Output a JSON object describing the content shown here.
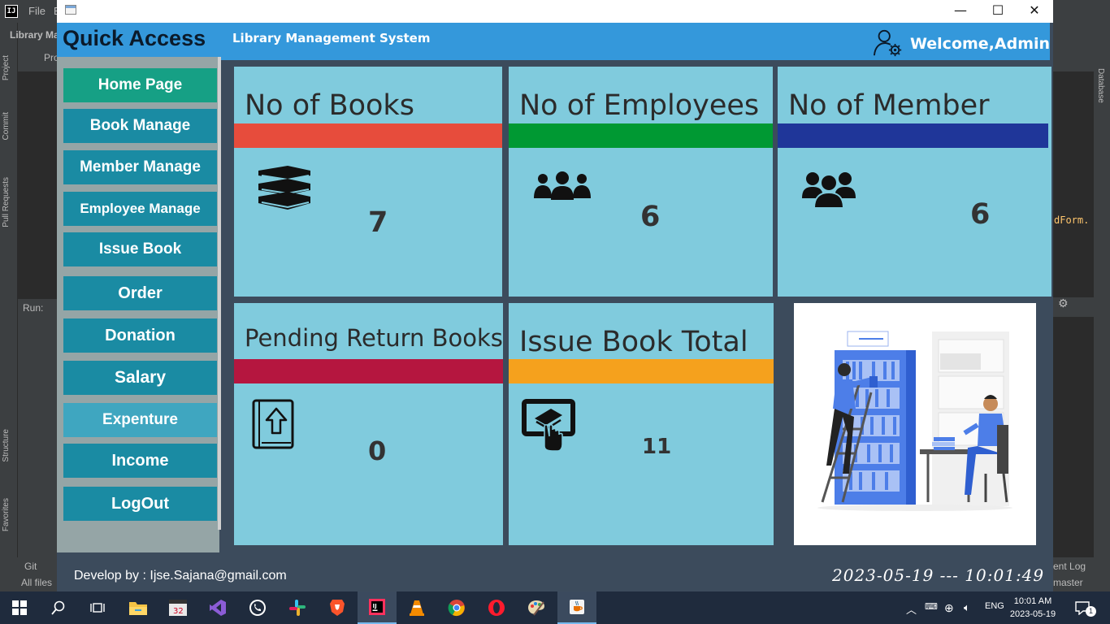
{
  "ide": {
    "menu_file": "File",
    "menu_edit": "E",
    "project_title": "Library Ma",
    "project_node": "Pro",
    "run_label": "Run:",
    "left_tabs": [
      "Project",
      "Commit",
      "Pull Requests",
      "Structure",
      "Favorites"
    ],
    "right_tab": "Database",
    "code_snippet": "dForm.",
    "git_label": "Git",
    "all_files": "All files",
    "event_log": "ent Log",
    "branch": "master"
  },
  "window": {
    "minimize": "—",
    "maximize": "☐",
    "close": "✕"
  },
  "header": {
    "quick_access": "Quick Access",
    "system_title": "Library Management System",
    "welcome": "Welcome,Admin"
  },
  "sidebar": {
    "items": [
      {
        "label": "Home Page"
      },
      {
        "label": "Book Manage"
      },
      {
        "label": "Member Manage"
      },
      {
        "label": "Employee Manage"
      },
      {
        "label": "Issue Book"
      },
      {
        "label": "Order"
      },
      {
        "label": "Donation"
      },
      {
        "label": "Salary"
      },
      {
        "label": "Expenture"
      },
      {
        "label": "Income"
      },
      {
        "label": "LogOut"
      }
    ]
  },
  "cards": {
    "books": {
      "title": "No of Books",
      "value": "7",
      "bar_color": "#e74c3c"
    },
    "employees": {
      "title": "No of Employees",
      "value": "6",
      "bar_color": "#009933"
    },
    "members": {
      "title": "No of Member",
      "value": "6",
      "bar_color": "#1f3699"
    },
    "pending": {
      "title": "Pending Return Books",
      "value": "0",
      "bar_color": "#b5163f"
    },
    "issued": {
      "title": "Issue Book Total",
      "value": "11",
      "bar_color": "#f5a11d"
    }
  },
  "footer": {
    "developer": "Develop by : Ijse.Sajana@gmail.com",
    "datetime": "2023-05-19 --- 10:01:49"
  },
  "taskbar": {
    "language": "ENG",
    "time": "10:01 AM",
    "date": "2023-05-19",
    "notifications": "1"
  }
}
